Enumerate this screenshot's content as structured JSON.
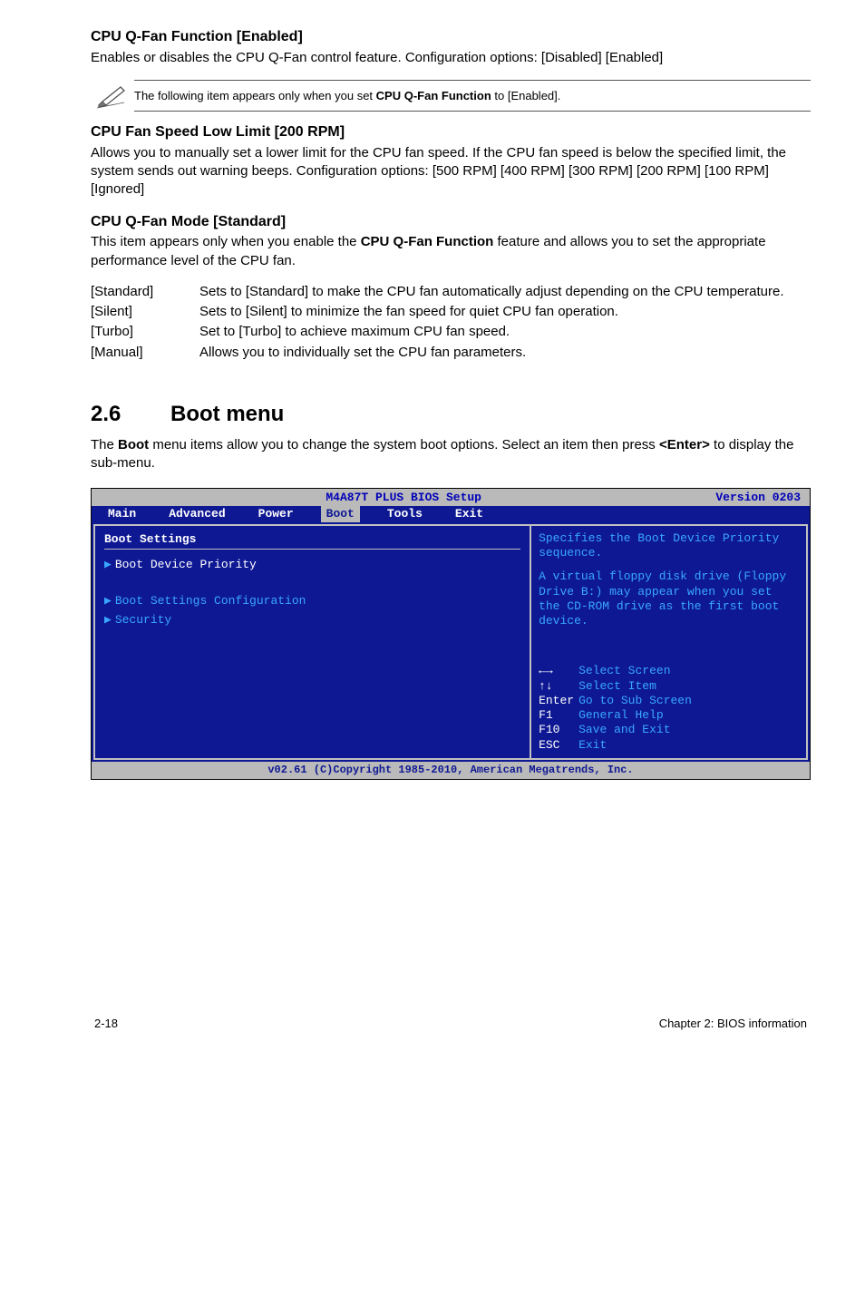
{
  "sec1": {
    "title": "CPU Q-Fan Function [Enabled]",
    "body": "Enables or disables the CPU Q-Fan control feature. Configuration options: [Disabled] [Enabled]"
  },
  "note1": {
    "pre": "The following item appears only when you set ",
    "bold": "CPU Q-Fan Function",
    "post": " to [Enabled]."
  },
  "sec2": {
    "title": "CPU Fan Speed Low Limit [200 RPM]",
    "body": "Allows you to manually set a lower limit for the CPU fan speed. If the CPU fan speed is below the specified limit, the system sends out warning beeps. Configuration options: [500 RPM] [400 RPM] [300 RPM] [200 RPM] [100 RPM] [Ignored]"
  },
  "sec3": {
    "title": "CPU Q-Fan Mode [Standard]",
    "body_pre": "This item appears only when you enable the ",
    "body_bold": "CPU Q-Fan Function",
    "body_post": " feature and allows you to set the appropriate performance level of the CPU fan.",
    "rows": [
      {
        "k": "[Standard]",
        "v": "Sets to [Standard] to make the CPU fan automatically adjust depending on the CPU temperature."
      },
      {
        "k": "[Silent]",
        "v": "Sets to [Silent] to minimize the fan speed for quiet CPU fan operation."
      },
      {
        "k": "[Turbo]",
        "v": "Set to [Turbo] to achieve maximum CPU fan speed."
      },
      {
        "k": "[Manual]",
        "v": "Allows you to individually set the CPU fan parameters."
      }
    ]
  },
  "chapter": {
    "num": "2.6",
    "title": "Boot menu",
    "intro_pre": "The ",
    "intro_b1": "Boot",
    "intro_mid": " menu items allow you to change the system boot options. Select an item then press ",
    "intro_b2": "<Enter>",
    "intro_post": " to display the sub-menu."
  },
  "bios": {
    "title": "M4A87T PLUS BIOS Setup",
    "version": "Version 0203",
    "tabs": [
      "Main",
      "Advanced",
      "Power",
      "Boot",
      "Tools",
      "Exit"
    ],
    "selected_tab": "Boot",
    "left": {
      "heading": "Boot Settings",
      "items": [
        "Boot Device Priority",
        "Boot Settings Configuration",
        "Security"
      ]
    },
    "right": {
      "help1": "Specifies the Boot Device Priority sequence.",
      "help2": "A virtual floppy disk drive (Floppy Drive B:) may appear when you set the CD-ROM drive as the first boot device.",
      "keys": [
        {
          "k": "←→",
          "v": "Select Screen"
        },
        {
          "k": "↑↓",
          "v": "Select Item"
        },
        {
          "k": "Enter",
          "v": "Go to Sub Screen"
        },
        {
          "k": "F1",
          "v": "General Help"
        },
        {
          "k": "F10",
          "v": "Save and Exit"
        },
        {
          "k": "ESC",
          "v": "Exit"
        }
      ]
    },
    "footer": "v02.61 (C)Copyright 1985-2010, American Megatrends, Inc."
  },
  "pagefoot": {
    "left": "2-18",
    "right": "Chapter 2: BIOS information"
  }
}
